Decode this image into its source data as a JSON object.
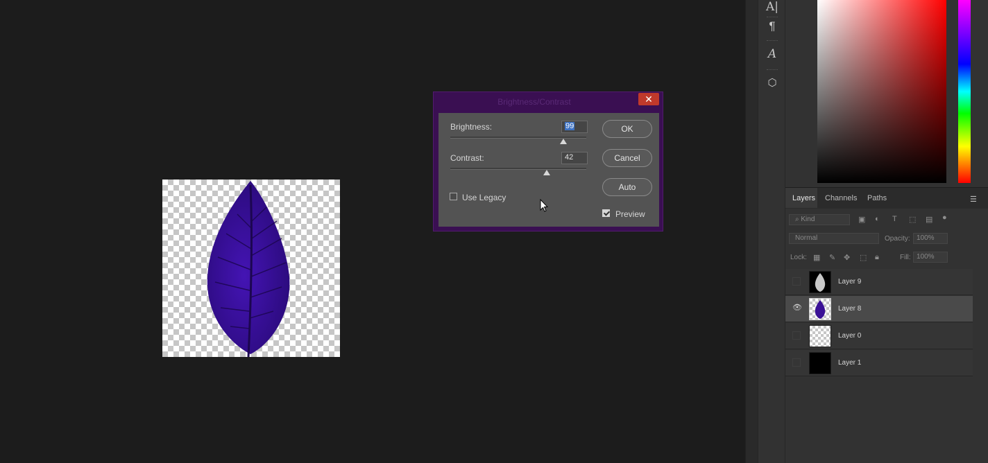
{
  "dialog": {
    "title": "Brightness/Contrast",
    "close": "✕",
    "brightness_label": "Brightness:",
    "brightness_value": "99",
    "contrast_label": "Contrast:",
    "contrast_value": "42",
    "use_legacy_label": "Use Legacy",
    "use_legacy_checked": false,
    "preview_label": "Preview",
    "preview_checked": true,
    "ok_label": "OK",
    "cancel_label": "Cancel",
    "auto_label": "Auto"
  },
  "panel_tabs": [
    "Layers",
    "Channels",
    "Paths"
  ],
  "layers_panel": {
    "filter_placeholder": "Kind",
    "blend_mode": "Normal",
    "opacity_label": "Opacity:",
    "opacity_value": "100%",
    "lock_label": "Lock:",
    "fill_label": "Fill:",
    "fill_value": "100%"
  },
  "layers": [
    {
      "name": "Layer 9",
      "visible": false,
      "thumb": "white-leaf"
    },
    {
      "name": "Layer 8",
      "visible": true,
      "selected": true,
      "thumb": "purple-leaf"
    },
    {
      "name": "Layer 0",
      "visible": false,
      "thumb": "transparent"
    },
    {
      "name": "Layer 1",
      "visible": false,
      "thumb": "black"
    }
  ],
  "colors": {
    "leaf": "#3a1196",
    "dialog_frame": "#3a0f52",
    "close_button": "#c0392b",
    "selection": "#3d72c4"
  }
}
